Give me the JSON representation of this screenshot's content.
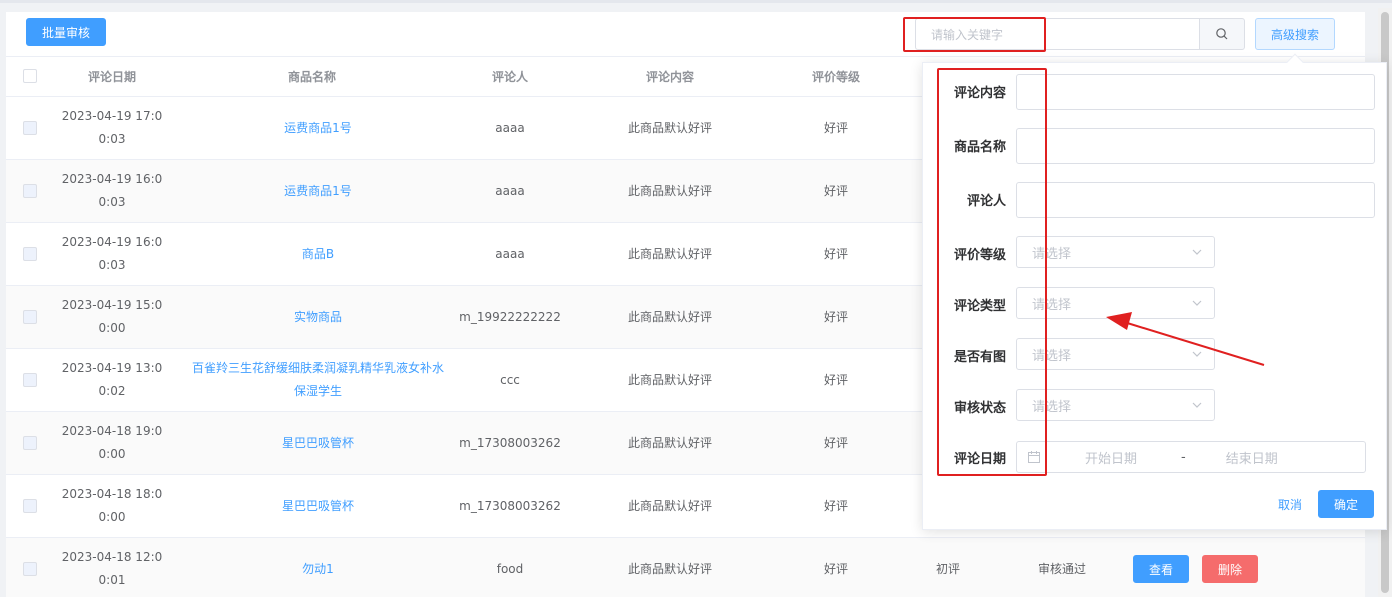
{
  "toolbar": {
    "batch_review_label": "批量审核",
    "search_placeholder": "请输入关键字",
    "advanced_search_label": "高级搜索"
  },
  "table": {
    "headers": [
      "评论日期",
      "商品名称",
      "评论人",
      "评论内容",
      "评价等级"
    ],
    "rows": [
      {
        "date1": "2023-04-19 17:0",
        "date2": "0:03",
        "product": "运费商品1号",
        "user": "aaaa",
        "content": "此商品默认好评",
        "grade": "好评"
      },
      {
        "date1": "2023-04-19 16:0",
        "date2": "0:03",
        "product": "运费商品1号",
        "user": "aaaa",
        "content": "此商品默认好评",
        "grade": "好评"
      },
      {
        "date1": "2023-04-19 16:0",
        "date2": "0:03",
        "product": "商品B",
        "user": "aaaa",
        "content": "此商品默认好评",
        "grade": "好评"
      },
      {
        "date1": "2023-04-19 15:0",
        "date2": "0:00",
        "product": "实物商品",
        "user": "m_19922222222",
        "content": "此商品默认好评",
        "grade": "好评"
      },
      {
        "date1": "2023-04-19 13:0",
        "date2": "0:02",
        "product": "百雀羚三生花舒缓细肤柔润凝乳精华乳液女补水",
        "product2": "保湿学生",
        "user": "ccc",
        "content": "此商品默认好评",
        "grade": "好评"
      },
      {
        "date1": "2023-04-18 19:0",
        "date2": "0:00",
        "product": "星巴巴吸管杯",
        "user": "m_17308003262",
        "content": "此商品默认好评",
        "grade": "好评"
      },
      {
        "date1": "2023-04-18 18:0",
        "date2": "0:00",
        "product": "星巴巴吸管杯",
        "user": "m_17308003262",
        "content": "此商品默认好评",
        "grade": "好评"
      },
      {
        "date1": "2023-04-18 12:0",
        "date2": "0:01",
        "product": "勿动1",
        "user": "food",
        "content": "此商品默认好评",
        "grade": "好评",
        "type": "初评",
        "status": "审核通过",
        "view_label": "查看",
        "delete_label": "删除"
      }
    ]
  },
  "advanced_search": {
    "labels": [
      "评论内容",
      "商品名称",
      "评论人",
      "评价等级",
      "评论类型",
      "是否有图",
      "审核状态",
      "评论日期"
    ],
    "select_placeholder": "请选择",
    "start_date_placeholder": "开始日期",
    "date_separator": "-",
    "end_date_placeholder": "结束日期",
    "cancel_label": "取消",
    "confirm_label": "确定"
  },
  "colors": {
    "primary": "#409eff",
    "danger": "#f56c6c",
    "annotation": "#e02020"
  }
}
